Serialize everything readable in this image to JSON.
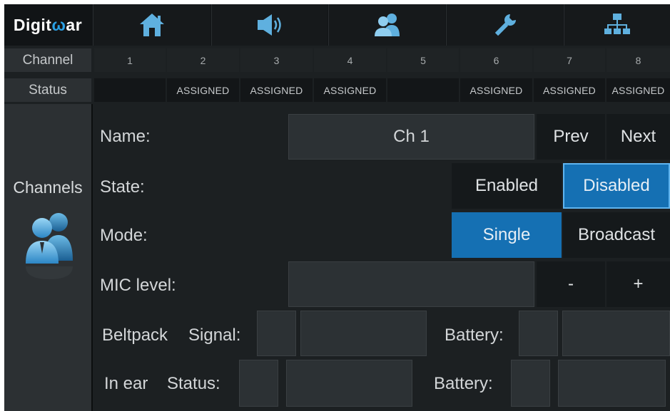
{
  "app": {
    "logo_prefix": "D",
    "logo_mid": "igit",
    "logo_accent": "ω",
    "logo_suffix": "ar"
  },
  "nav": [
    {
      "id": "home",
      "icon": "home-icon"
    },
    {
      "id": "audio",
      "icon": "speaker-icon"
    },
    {
      "id": "channels",
      "icon": "users-icon"
    },
    {
      "id": "settings",
      "icon": "wrench-icon"
    },
    {
      "id": "network",
      "icon": "network-icon"
    }
  ],
  "table": {
    "channel_label": "Channel",
    "status_label": "Status",
    "channels": [
      "1",
      "2",
      "3",
      "4",
      "5",
      "6",
      "7",
      "8"
    ],
    "statuses": [
      "",
      "ASSIGNED",
      "ASSIGNED",
      "ASSIGNED",
      "",
      "ASSIGNED",
      "ASSIGNED",
      "ASSIGNED"
    ]
  },
  "sidebar": {
    "label": "Channels",
    "icon": "users-icon"
  },
  "form": {
    "name_label": "Name:",
    "name_value": "Ch 1",
    "prev_label": "Prev",
    "next_label": "Next",
    "state_label": "State:",
    "enabled_label": "Enabled",
    "disabled_label": "Disabled",
    "state_selected": "Disabled",
    "mode_label": "Mode:",
    "single_label": "Single",
    "broadcast_label": "Broadcast",
    "mode_selected": "Single",
    "mic_label": "MIC level:",
    "mic_value": "",
    "minus_label": "-",
    "plus_label": "+",
    "beltpack_label": "Beltpack",
    "signal_label": "Signal:",
    "battery_label": "Battery:",
    "inear_label": "In ear",
    "status_label": "Status:",
    "battery2_label": "Battery:"
  },
  "colors": {
    "accent": "#1570b3",
    "accent_light": "#5fb4ef",
    "bg": "#1c2022",
    "panel": "#2c3033"
  }
}
